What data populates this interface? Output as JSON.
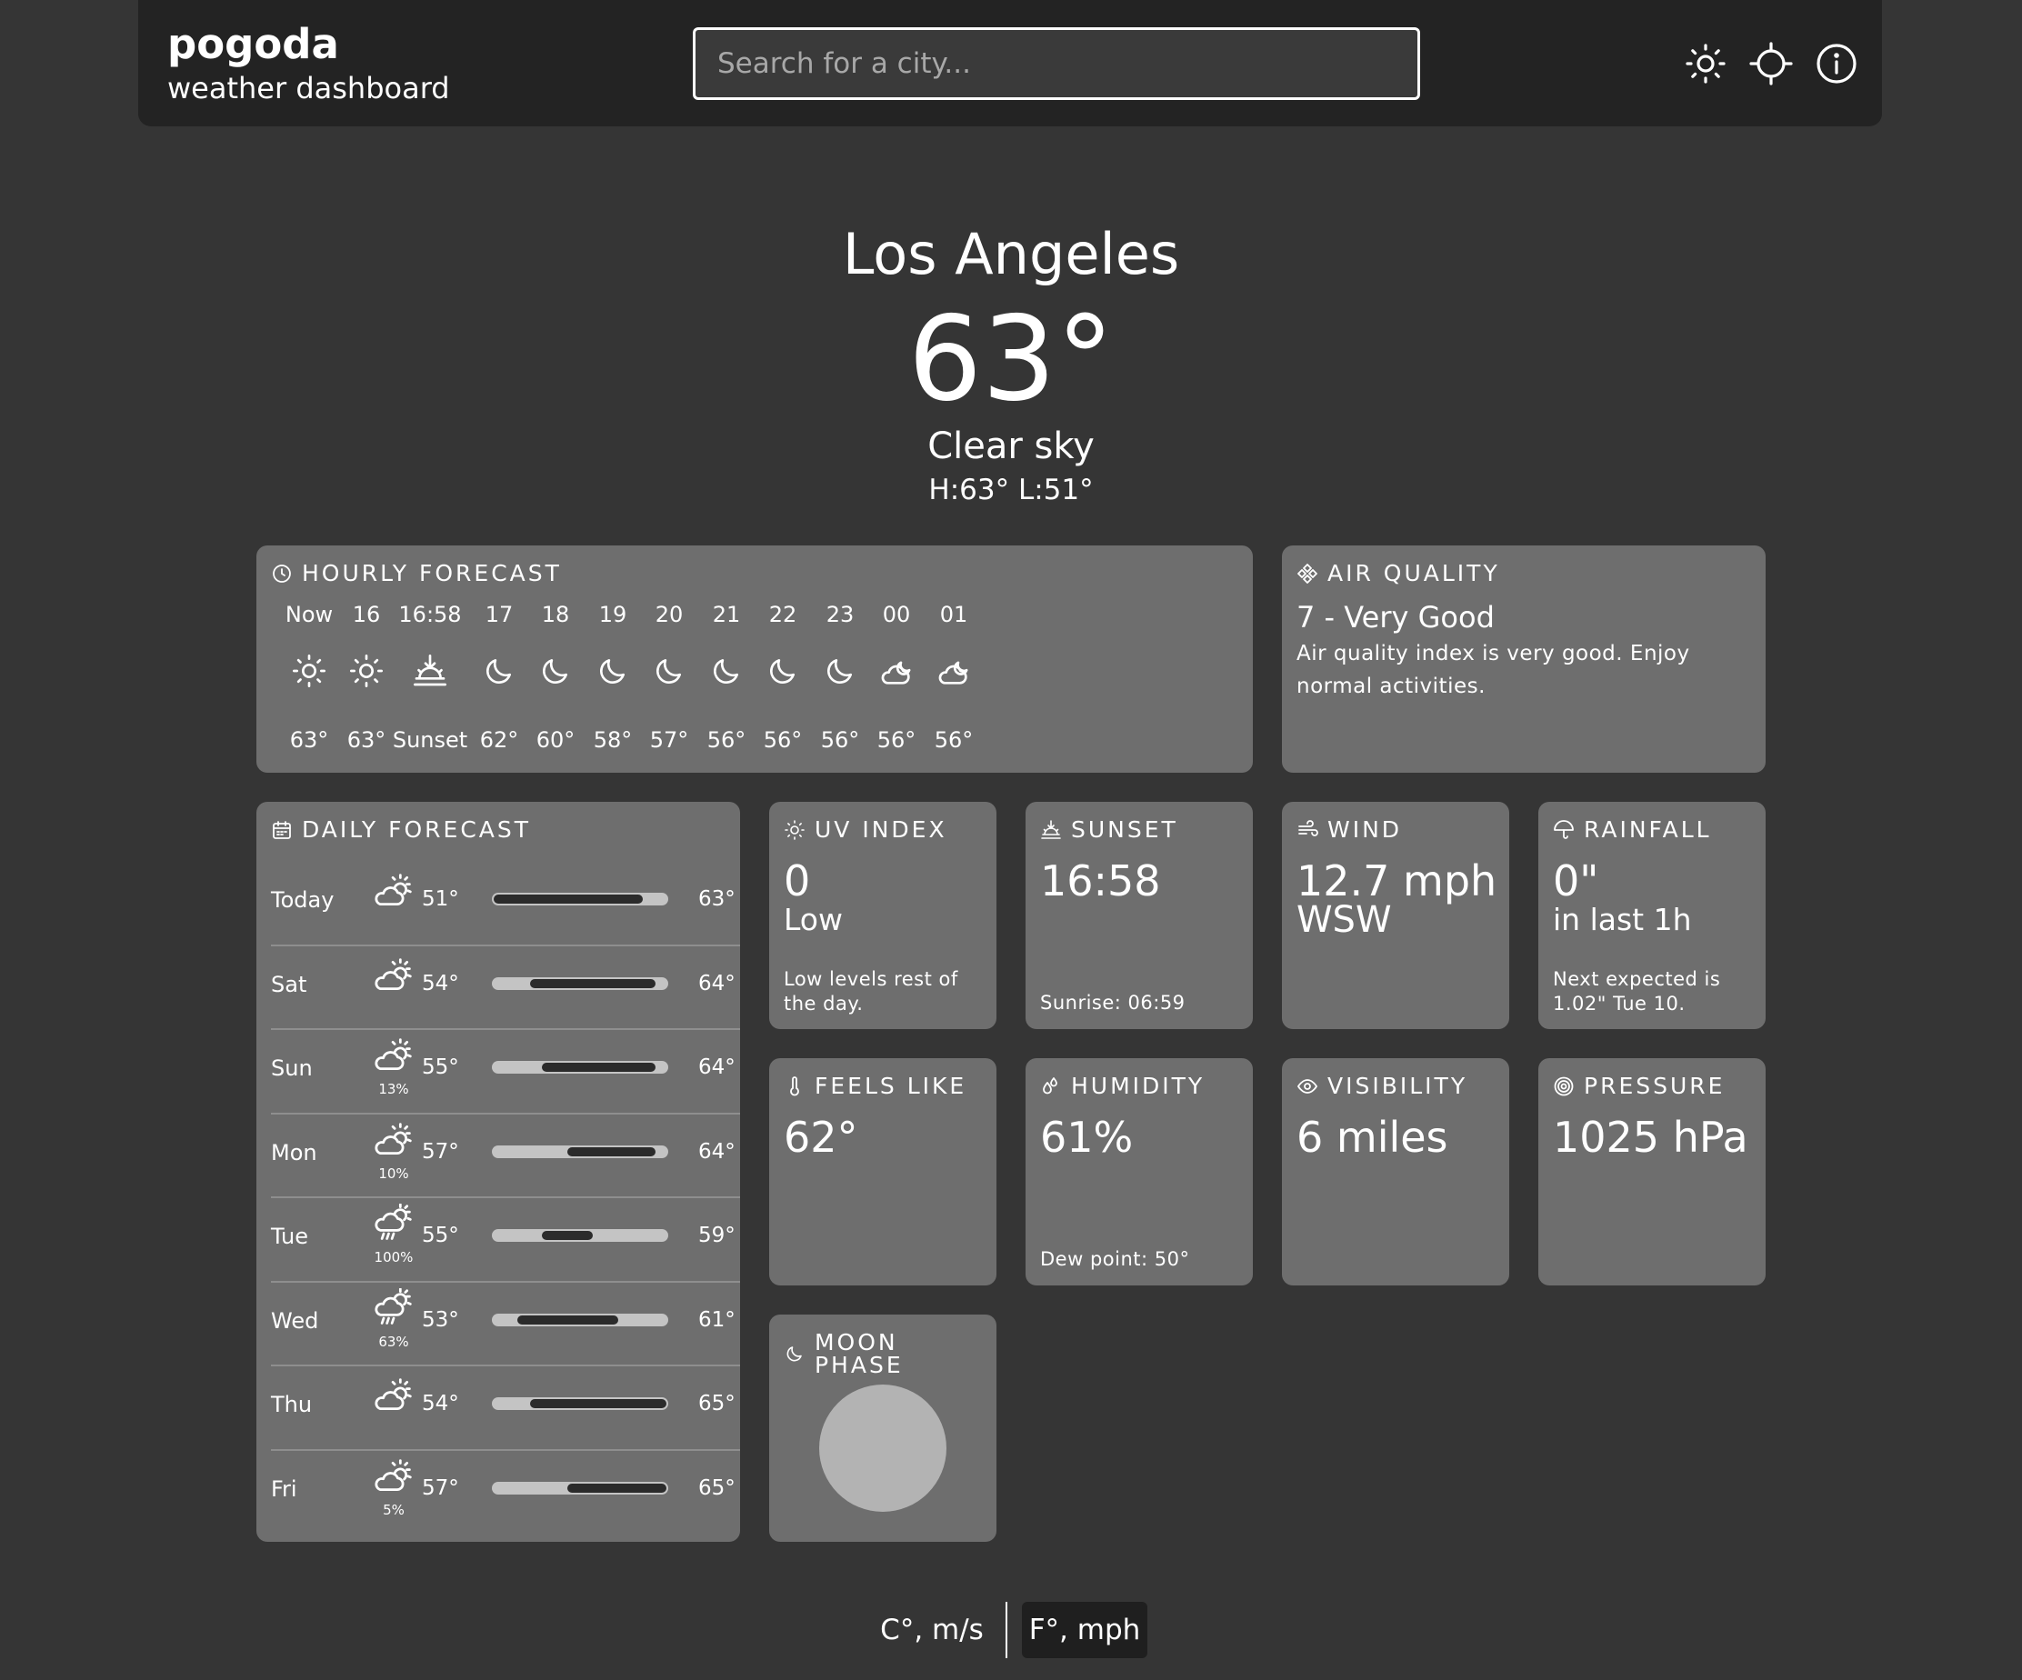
{
  "app": {
    "title": "pogoda",
    "subtitle": "weather dashboard"
  },
  "search": {
    "placeholder": "Search for a city..."
  },
  "header_buttons": [
    {
      "icon": "sun-icon",
      "label": "theme"
    },
    {
      "icon": "crosshair-icon",
      "label": "locate"
    },
    {
      "icon": "info-icon",
      "label": "info"
    }
  ],
  "current": {
    "city": "Los Angeles",
    "temperature": "63°",
    "condition": "Clear sky",
    "high_low": "H:63° L:51°"
  },
  "hourly": {
    "title": "HOURLY FORECAST",
    "items": [
      {
        "time": "Now",
        "icon": "sun-icon",
        "value": "63°"
      },
      {
        "time": "16",
        "icon": "sun-icon",
        "value": "63°"
      },
      {
        "time": "16:58",
        "icon": "sunset-icon",
        "value": "Sunset"
      },
      {
        "time": "17",
        "icon": "moon-icon",
        "value": "62°"
      },
      {
        "time": "18",
        "icon": "moon-icon",
        "value": "60°"
      },
      {
        "time": "19",
        "icon": "moon-icon",
        "value": "58°"
      },
      {
        "time": "20",
        "icon": "moon-icon",
        "value": "57°"
      },
      {
        "time": "21",
        "icon": "moon-icon",
        "value": "56°"
      },
      {
        "time": "22",
        "icon": "moon-icon",
        "value": "56°"
      },
      {
        "time": "23",
        "icon": "moon-icon",
        "value": "56°"
      },
      {
        "time": "00",
        "icon": "cloud-moon-icon",
        "value": "56°"
      },
      {
        "time": "01",
        "icon": "cloud-moon-icon",
        "value": "56°"
      }
    ]
  },
  "air_quality": {
    "title": "AIR QUALITY",
    "value": "7 - Very Good",
    "description": "Air quality index is very good. Enjoy normal activities."
  },
  "daily": {
    "title": "DAILY FORECAST",
    "range_min": 51,
    "range_max": 65,
    "days": [
      {
        "day": "Today",
        "icon": "cloud-sun-icon",
        "precip": "",
        "low": "51°",
        "high": "63°",
        "low_val": 51,
        "high_val": 63
      },
      {
        "day": "Sat",
        "icon": "cloud-sun-icon",
        "precip": "",
        "low": "54°",
        "high": "64°",
        "low_val": 54,
        "high_val": 64
      },
      {
        "day": "Sun",
        "icon": "cloud-sun-icon",
        "precip": "13%",
        "low": "55°",
        "high": "64°",
        "low_val": 55,
        "high_val": 64
      },
      {
        "day": "Mon",
        "icon": "cloud-sun-icon",
        "precip": "10%",
        "low": "57°",
        "high": "64°",
        "low_val": 57,
        "high_val": 64
      },
      {
        "day": "Tue",
        "icon": "cloud-sun-rain-icon",
        "precip": "100%",
        "low": "55°",
        "high": "59°",
        "low_val": 55,
        "high_val": 59
      },
      {
        "day": "Wed",
        "icon": "cloud-sun-rain-icon",
        "precip": "63%",
        "low": "53°",
        "high": "61°",
        "low_val": 53,
        "high_val": 61
      },
      {
        "day": "Thu",
        "icon": "cloud-sun-icon",
        "precip": "",
        "low": "54°",
        "high": "65°",
        "low_val": 54,
        "high_val": 65
      },
      {
        "day": "Fri",
        "icon": "cloud-sun-icon",
        "precip": "5%",
        "low": "57°",
        "high": "65°",
        "low_val": 57,
        "high_val": 65
      }
    ]
  },
  "uv": {
    "title": "UV INDEX",
    "value": "0",
    "level": "Low",
    "note": "Low levels rest of the day."
  },
  "sunset": {
    "title": "SUNSET",
    "value": "16:58",
    "note": "Sunrise: 06:59"
  },
  "wind": {
    "title": "WIND",
    "value": "12.7 mph",
    "direction": "WSW"
  },
  "rainfall": {
    "title": "RAINFALL",
    "value": "0\"",
    "period": "in last 1h",
    "note": "Next expected is 1.02\" Tue 10."
  },
  "feels_like": {
    "title": "FEELS LIKE",
    "value": "62°"
  },
  "humidity": {
    "title": "HUMIDITY",
    "value": "61%",
    "note": "Dew point: 50°"
  },
  "visibility": {
    "title": "VISIBILITY",
    "value": "6 miles"
  },
  "pressure": {
    "title": "PRESSURE",
    "value": "1025 hPa"
  },
  "moon": {
    "title": "MOON PHASE",
    "illumination": 1.0
  },
  "units": {
    "metric": "C°, m/s",
    "imperial": "F°, mph",
    "selected": "imperial"
  },
  "colors": {
    "background": "#353535",
    "header": "#232323",
    "card": "#6e6e6e",
    "bar_track": "#c4c4c4",
    "bar_fill": "#2b2b2b",
    "moon": "#b3b3b3"
  }
}
